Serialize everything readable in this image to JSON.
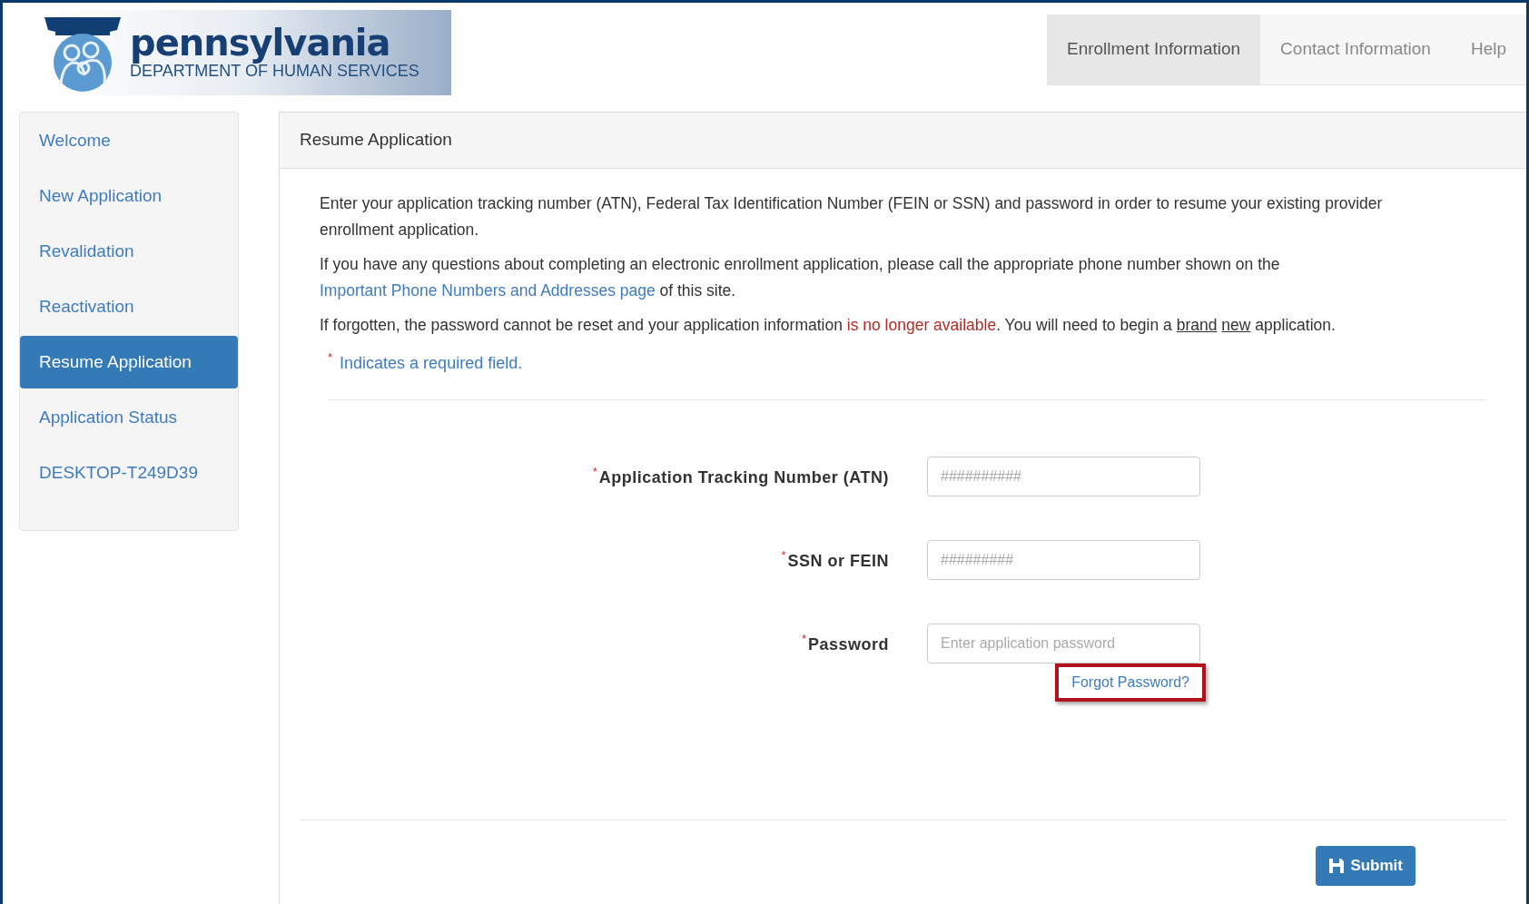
{
  "logo": {
    "title": "pennsylvania",
    "subtitle": "DEPARTMENT OF HUMAN SERVICES"
  },
  "nav": [
    {
      "label": "Enrollment Information",
      "selected": true
    },
    {
      "label": "Contact Information",
      "selected": false
    },
    {
      "label": "Help",
      "selected": false
    }
  ],
  "sidebar": {
    "items": [
      {
        "label": "Welcome",
        "selected": false
      },
      {
        "label": "New Application",
        "selected": false
      },
      {
        "label": "Revalidation",
        "selected": false
      },
      {
        "label": "Reactivation",
        "selected": false
      },
      {
        "label": "Resume Application",
        "selected": true
      },
      {
        "label": "Application Status",
        "selected": false
      },
      {
        "label": "DESKTOP-T249D39",
        "selected": false
      }
    ]
  },
  "panel": {
    "title": "Resume Application",
    "paragraphs": [
      [
        {
          "kind": "plain",
          "text": "Enter your application tracking number (ATN), Federal Tax Identification Number (FEIN or SSN) and password in order to resume your existing provider enrollment application."
        }
      ],
      [
        {
          "kind": "plain",
          "text": "If you have any questions about completing an electronic enrollment application, please call the appropriate phone number shown on the "
        },
        {
          "kind": "link",
          "text": "Important Phone Numbers and Addresses page"
        },
        {
          "kind": "plain",
          "text": " of this site."
        }
      ],
      [
        {
          "kind": "plain",
          "text": "If forgotten, the password cannot be reset and your application information "
        },
        {
          "kind": "warning",
          "text": "is no longer available"
        },
        {
          "kind": "plain",
          "text": ". You will need to begin a "
        },
        {
          "kind": "underline",
          "text": "brand"
        },
        {
          "kind": "underline",
          "text": "new"
        },
        {
          "kind": "plain",
          "text": " application."
        }
      ]
    ],
    "required_note": {
      "mark": "*",
      "text": "Indicates a required field."
    },
    "fields": [
      {
        "mark": "*",
        "label": "Application Tracking Number (ATN)",
        "placeholder": "##########"
      },
      {
        "mark": "*",
        "label": "SSN or FEIN",
        "placeholder": "#########"
      },
      {
        "mark": "*",
        "label": "Password",
        "placeholder": "Enter application password",
        "link": "Forgot Password?"
      }
    ],
    "submit": "Submit"
  }
}
